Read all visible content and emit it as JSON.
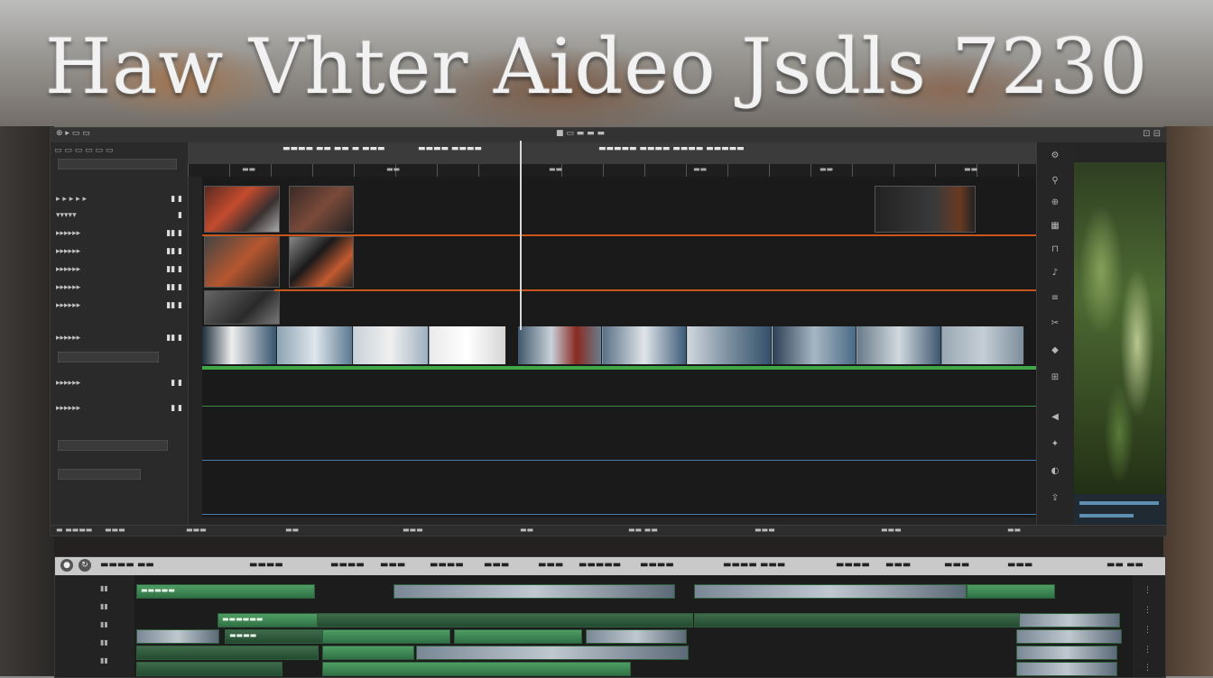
{
  "hero": {
    "title": "Haw Vhter  Aideo  Jsdls 7230"
  },
  "editor": {
    "top_bar": {
      "left_text": "⊕ ▸ ▭ ▭",
      "center_text": "■ ▭ ▬ ▬ ▬",
      "right_text": "⊡ ⊟"
    },
    "left_panel": {
      "rows": [
        {
          "label": "▸ ▸ ▸ ▸ ▸",
          "value": "▮ ▮"
        },
        {
          "label": "▾▾▾▾▾",
          "value": "▮"
        },
        {
          "label": "▸▸▸▸▸▸",
          "value": "▮▮ ▮"
        },
        {
          "label": "▸▸▸▸▸▸",
          "value": "▮▮ ▮"
        },
        {
          "label": "▸▸▸▸▸▸",
          "value": "▮▮ ▮"
        },
        {
          "label": "▸▸▸▸▸▸",
          "value": "▮▮ ▮"
        },
        {
          "label": "▸▸▸▸▸▸",
          "value": "▮▮ ▮"
        },
        {
          "label": "▸▸▸▸▸▸",
          "value": "▮▮ ▮"
        },
        {
          "label": "▸▸▸▸▸▸",
          "value": "▮ ▮"
        },
        {
          "label": "▸▸▸▸▸▸",
          "value": "▮ ▮"
        }
      ]
    },
    "tabs": [
      {
        "label": "▬▬▬▬ ▬▬ ▬▬ ▬ ▬▬▬"
      },
      {
        "label": "▬▬▬▬ ▬▬▬▬"
      },
      {
        "label": "▬▬▬▬▬ ▬▬▬▬ ▬▬▬▬ ▬▬▬▬▬"
      }
    ],
    "ruler_ticks": [
      "▬▬",
      "▬▬",
      "▬▬",
      "▬▬",
      "▬▬",
      "▬▬"
    ],
    "bottom_status": [
      "▬ ▬▬▬▬",
      "▬▬▬",
      "▬▬▬",
      "▬▬",
      "▬▬▬",
      "▬▬",
      "▬▬ ▬▬",
      "▬▬▬",
      "▬▬▬",
      "▬▬"
    ]
  },
  "timeline2": {
    "tabs": [
      "▬▬▬▬ ▬▬",
      "▬▬▬▬",
      "▬▬▬▬",
      "▬▬▬",
      "▬▬▬▬",
      "▬▬▬",
      "▬▬▬",
      "▬▬▬▬▬",
      "▬▬▬▬",
      "▬▬▬▬ ▬▬▬",
      "▬▬▬▬",
      "▬▬▬",
      "▬▬▬",
      "▬▬▬",
      "▬▬ ▬▬"
    ],
    "clip_labels": [
      "▬▬▬▬▬",
      "▬▬▬▬▬▬",
      "▬▬▬▬"
    ]
  },
  "colors": {
    "accent_orange": "#c8561c",
    "accent_green": "#41a84a",
    "accent_blue": "#4a78b0"
  }
}
